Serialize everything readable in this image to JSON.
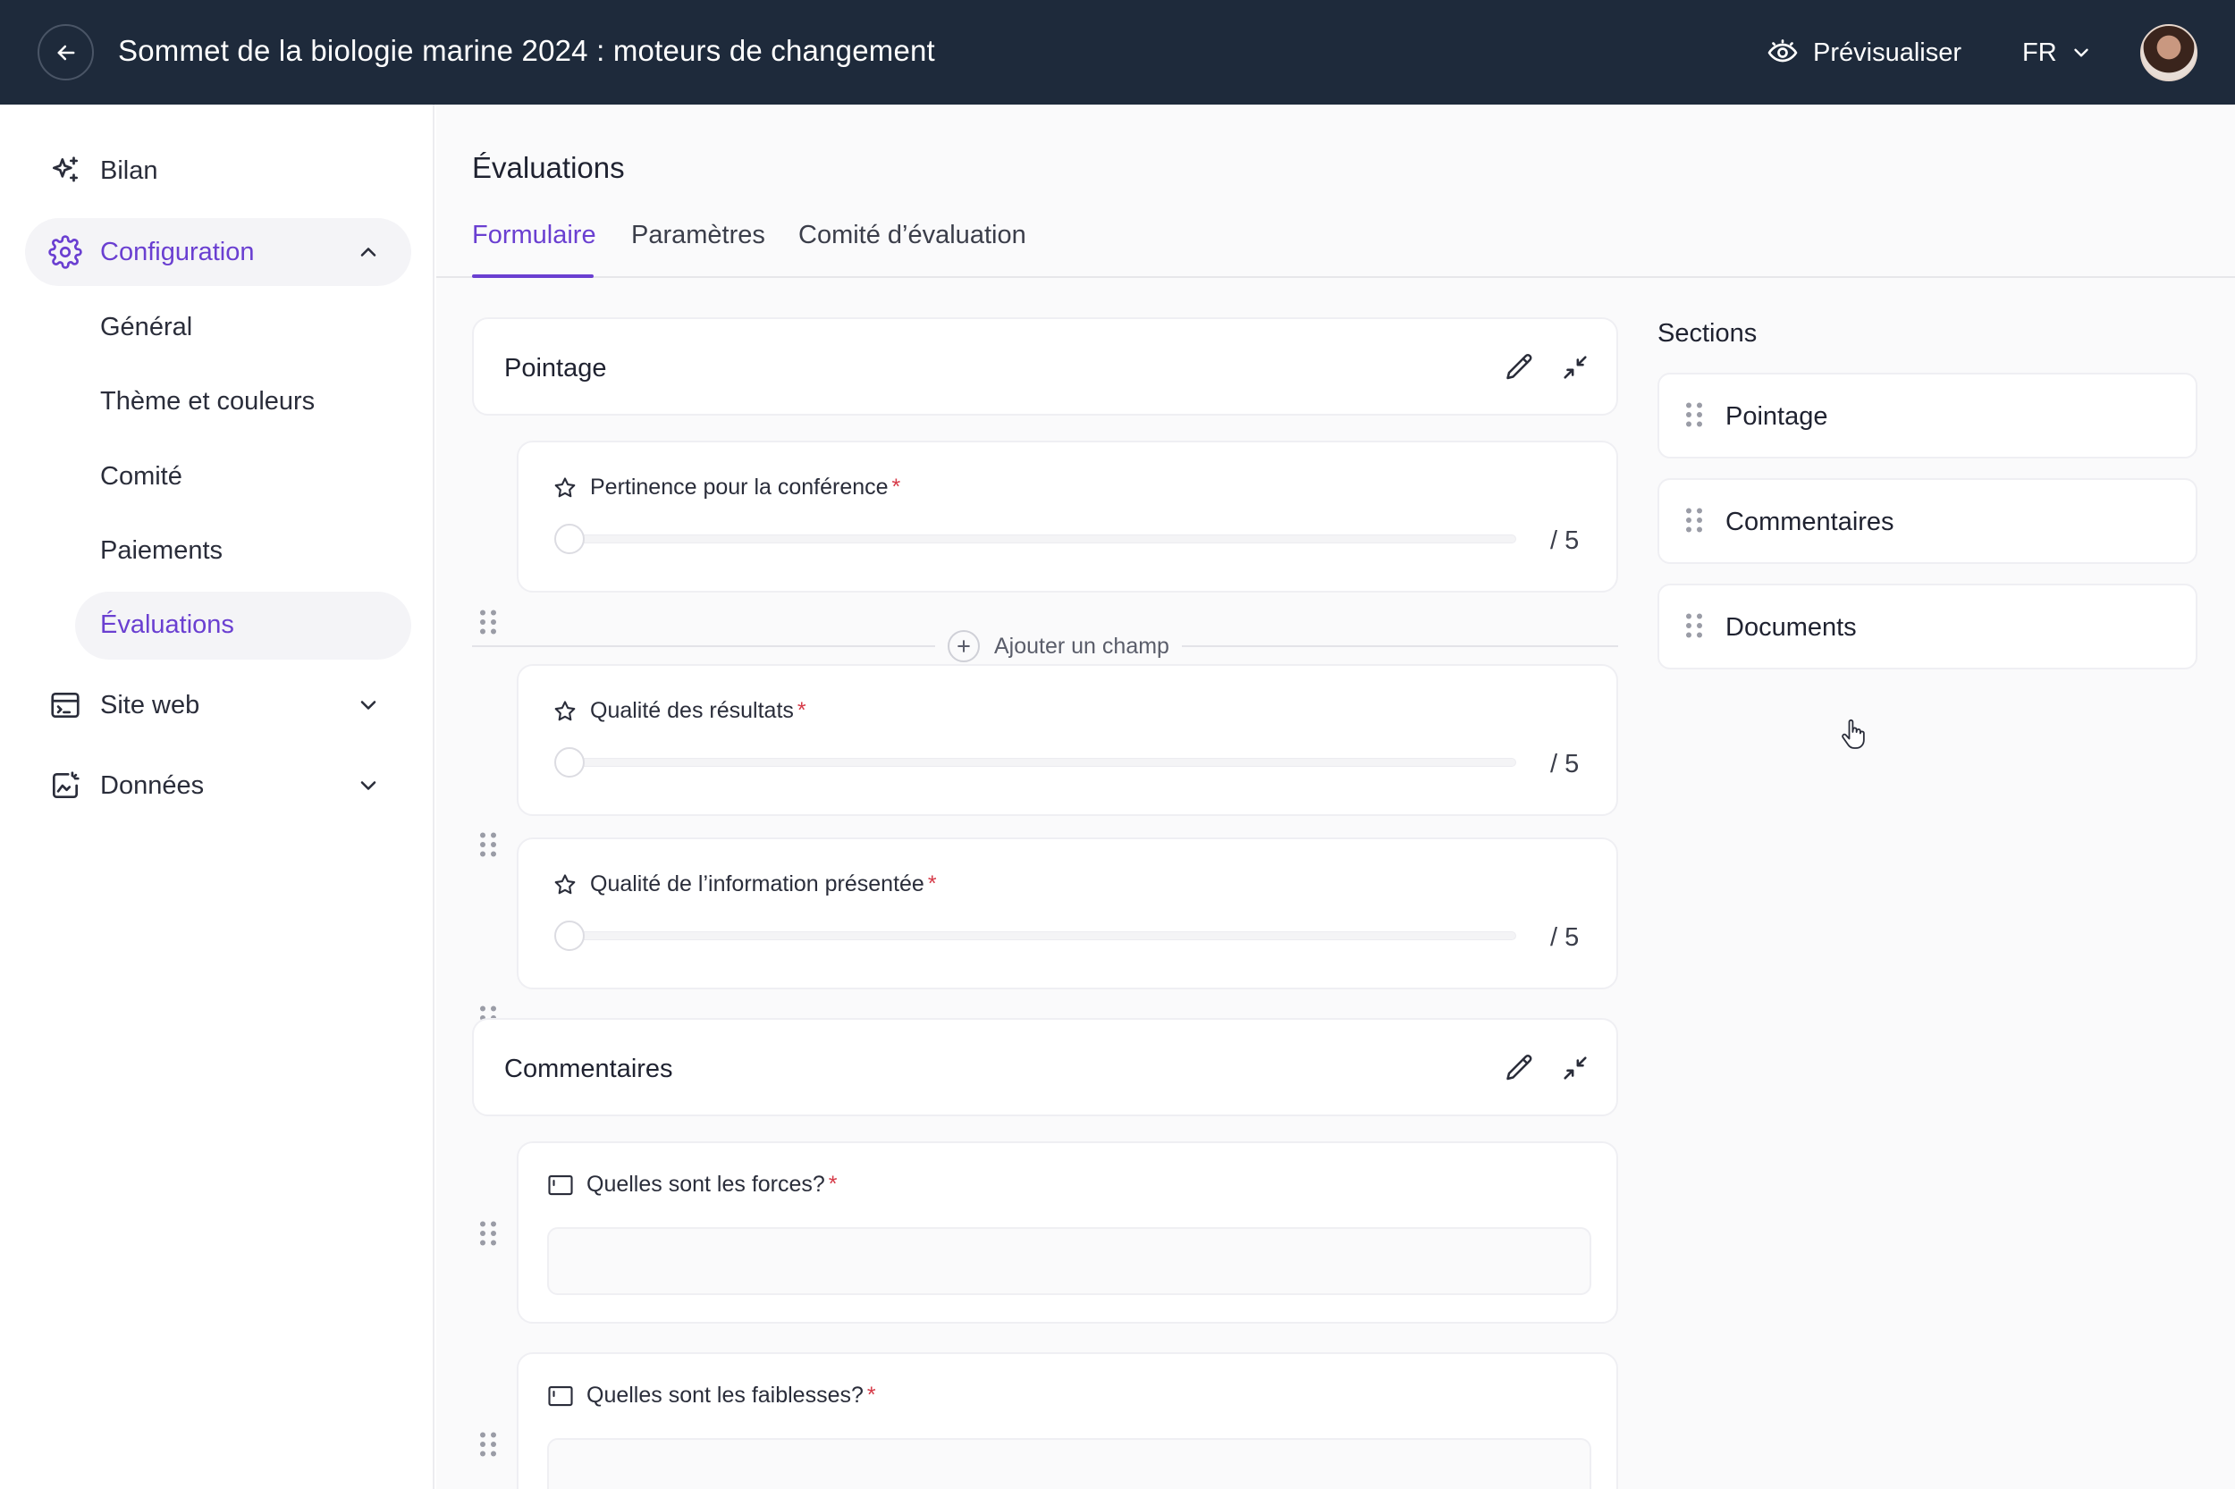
{
  "header": {
    "title": "Sommet de la biologie marine 2024 : moteurs de changement",
    "preview_label": "Prévisualiser",
    "language": "FR"
  },
  "sidebar": {
    "items": [
      {
        "label": "Bilan",
        "icon": "sparkles-icon"
      },
      {
        "label": "Configuration",
        "icon": "gear-icon",
        "expanded": true,
        "active": true
      },
      {
        "label": "Site web",
        "icon": "browser-icon",
        "expanded": false
      },
      {
        "label": "Données",
        "icon": "data-icon",
        "expanded": false
      }
    ],
    "config_subitems": [
      {
        "label": "Général"
      },
      {
        "label": "Thème et couleurs"
      },
      {
        "label": "Comité"
      },
      {
        "label": "Paiements"
      },
      {
        "label": "Évaluations",
        "active": true
      }
    ]
  },
  "main": {
    "title": "Évaluations",
    "tabs": [
      {
        "label": "Formulaire",
        "active": true
      },
      {
        "label": "Paramètres"
      },
      {
        "label": "Comité d’évaluation"
      }
    ],
    "sections": [
      {
        "title": "Pointage",
        "fields": [
          {
            "label": "Pertinence pour la conférence",
            "type": "rating",
            "max": "/ 5",
            "required": "*"
          },
          {
            "label": "Qualité des résultats",
            "type": "rating",
            "max": "/ 5",
            "required": "*"
          },
          {
            "label": "Qualité de l’information présentée",
            "type": "rating",
            "max": "/ 5",
            "required": "*"
          }
        ],
        "add_field_label": "Ajouter un champ"
      },
      {
        "title": "Commentaires",
        "fields": [
          {
            "label": "Quelles sont les forces?",
            "type": "text",
            "required": "*"
          },
          {
            "label": "Quelles sont les faiblesses?",
            "type": "text",
            "required": "*"
          }
        ]
      }
    ]
  },
  "sections_panel": {
    "title": "Sections",
    "items": [
      "Pointage",
      "Commentaires",
      "Documents"
    ]
  },
  "colors": {
    "topbar": "#1e2a3b",
    "accent": "#6a3fd1",
    "required": "#d63a48"
  }
}
